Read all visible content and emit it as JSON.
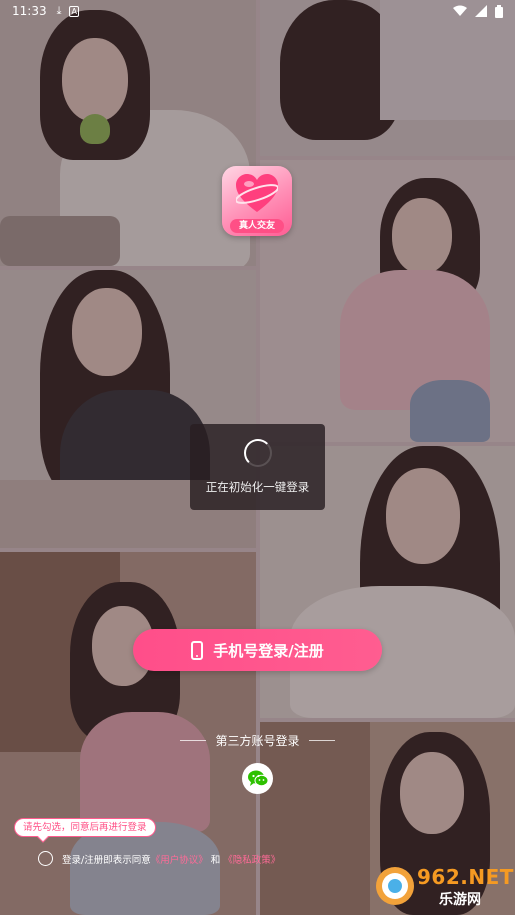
{
  "status_bar": {
    "time": "11:33",
    "left_icons": [
      "download-icon",
      "a-icon"
    ],
    "right_icons": [
      "wifi-icon",
      "signal-icon",
      "battery-icon"
    ]
  },
  "app": {
    "icon_label": "真人交友"
  },
  "loading": {
    "text": "正在初始化一键登录"
  },
  "phone_login": {
    "label": "手机号登录/注册"
  },
  "third_party": {
    "title": "第三方账号登录",
    "providers": [
      "wechat-icon"
    ]
  },
  "hint": {
    "text": "请先勾选，同意后再进行登录"
  },
  "agreement": {
    "prefix": "登录/注册即表示同意",
    "user_agreement": "《用户协议》",
    "and": "和",
    "privacy_policy": "《隐私政策》"
  },
  "watermark": {
    "brand": "962.NET",
    "sub": "乐游网"
  },
  "colors": {
    "accent": "#ff4e8a",
    "link": "#ff6b98",
    "wechat": "#2dc100"
  }
}
